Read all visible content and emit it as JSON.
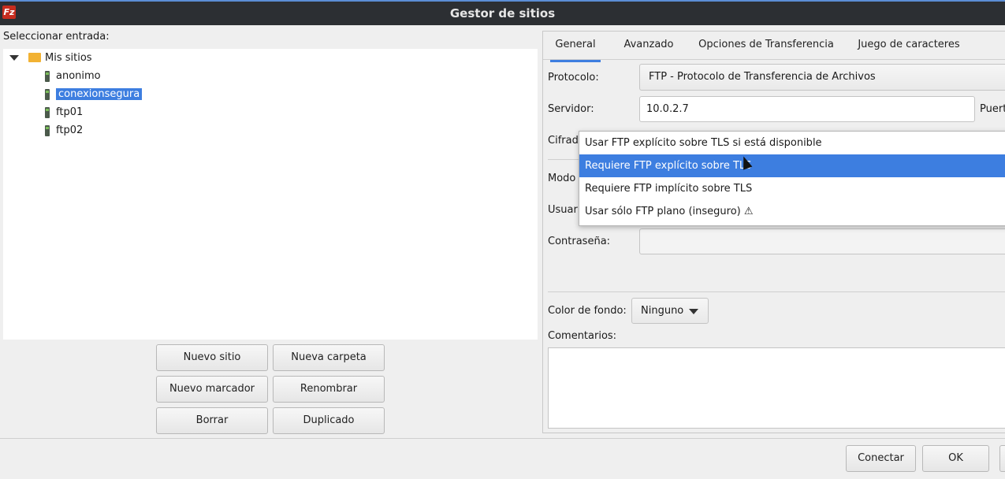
{
  "window": {
    "title": "Gestor de sitios",
    "app_icon": "filezilla-icon"
  },
  "left": {
    "select_label": "Seleccionar entrada:",
    "tree": {
      "root": "Mis sitios",
      "items": [
        "anonimo",
        "conexionsegura",
        "ftp01",
        "ftp02"
      ],
      "selected": "conexionsegura"
    },
    "buttons": {
      "new_site": "Nuevo sitio",
      "new_folder": "Nueva carpeta",
      "new_bookmark": "Nuevo marcador",
      "rename": "Renombrar",
      "delete": "Borrar",
      "duplicate": "Duplicado"
    }
  },
  "tabs": [
    "General",
    "Avanzado",
    "Opciones de Transferencia",
    "Juego de caracteres"
  ],
  "general": {
    "protocol_label": "Protocolo:",
    "protocol_value": "FTP - Protocolo de Transferencia de Archivos",
    "server_label": "Servidor:",
    "server_value": "10.0.2.7",
    "port_label": "Puert",
    "encryption_label": "Cifrad",
    "mode_label": "Modo",
    "user_label": "Usuar",
    "password_label": "Contraseña:",
    "password_value": "",
    "bg_color_label": "Color de fondo:",
    "bg_color_value": "Ninguno",
    "comments_label": "Comentarios:",
    "comments_value": ""
  },
  "encryption_dropdown": {
    "options": [
      "Usar FTP explícito sobre TLS si está disponible",
      "Requiere FTP explícito sobre TLS",
      "Requiere FTP implícito sobre TLS",
      "Usar sólo FTP plano (inseguro) ⚠"
    ],
    "highlighted_index": 1
  },
  "footer": {
    "connect": "Conectar",
    "ok": "OK"
  },
  "colors": {
    "accent": "#3d7ee0",
    "titlebar": "#2c2f33"
  }
}
